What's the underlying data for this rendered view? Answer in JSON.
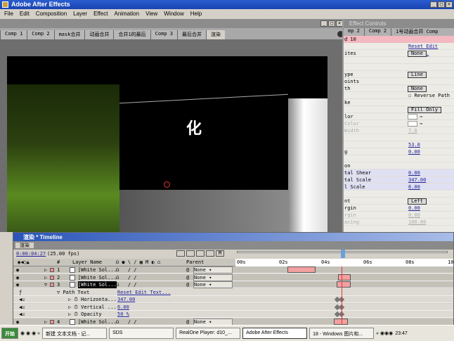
{
  "app": {
    "title": "Adobe After Effects"
  },
  "menu": [
    "File",
    "Edit",
    "Composition",
    "Layer",
    "Effect",
    "Animation",
    "View",
    "Window",
    "Help"
  ],
  "comp_tabs": [
    "Comp 1",
    "Comp 2",
    "mask合并",
    "动画合并",
    "合并1的最后",
    "Comp 3",
    "最后合并",
    "渲染"
  ],
  "viewer": {
    "text": "化"
  },
  "effect_controls": {
    "title": "Effect Controls",
    "tabs": [
      "mp 2",
      "Comp 2",
      "1号动画合并 Comp"
    ],
    "layer": "d 10",
    "rows": [
      {
        "label": "",
        "value": "Reset Edit Text..."
      },
      {
        "label": "ites",
        "value": "None"
      },
      {
        "label": "",
        "value": ""
      },
      {
        "label": "",
        "value": ""
      },
      {
        "label": "ype",
        "value": "Line"
      },
      {
        "label": "oints",
        "value": ""
      },
      {
        "label": "th",
        "value": "None"
      },
      {
        "label": "",
        "value": "Reverse Path"
      },
      {
        "label": "ke",
        "value": ""
      },
      {
        "label": "",
        "value": "Fill Only"
      },
      {
        "label": "lor",
        "value": ""
      },
      {
        "label": "Color",
        "value": ""
      },
      {
        "label": "Width",
        "value": "7.0"
      },
      {
        "label": "",
        "value": ""
      },
      {
        "label": "",
        "value": "53.0"
      },
      {
        "label": "g",
        "value": "0.00"
      },
      {
        "label": "",
        "value": ""
      },
      {
        "label": "on",
        "value": ""
      },
      {
        "label": "tal Shear",
        "value": "0.00"
      },
      {
        "label": "tal Scale",
        "value": "347.00"
      },
      {
        "label": "l Scale",
        "value": "6.00"
      },
      {
        "label": "",
        "value": ""
      },
      {
        "label": "nt",
        "value": "Left"
      },
      {
        "label": "rgin",
        "value": "0.00"
      },
      {
        "label": "rgin",
        "value": "0.00"
      },
      {
        "label": "acing",
        "value": "100.00"
      }
    ]
  },
  "timeline": {
    "title": "渲染 * Timeline",
    "tab": "渲染",
    "timecode": "0:00:04:27",
    "fps": "(25.00 fps)",
    "columns": {
      "num": "#",
      "layer_name": "Layer Name",
      "parent": "Parent"
    },
    "ruler": [
      "00s",
      "02s",
      "04s",
      "06s",
      "08s",
      "10"
    ],
    "layers": [
      {
        "num": "1",
        "name": "[White Sol...",
        "parent": "None"
      },
      {
        "num": "2",
        "name": "[White Sol...",
        "parent": "None"
      },
      {
        "num": "3",
        "name": "[White Sol...",
        "parent": "None"
      },
      {
        "num": "4",
        "name": "[White Sol...",
        "parent": "None"
      }
    ],
    "props": [
      {
        "name": "Path Text",
        "value": "Reset Edit Text..."
      },
      {
        "name": "Horizonta...",
        "value": "347.00"
      },
      {
        "name": "Vertical ...",
        "value": "6.00"
      },
      {
        "name": "Opacity",
        "value": "50 %"
      }
    ]
  },
  "taskbar": {
    "start": "开始",
    "tasks": [
      "新建 文本文档 - 记...",
      "SDS",
      "RealOne Player: d10_...",
      "Adobe After Effects",
      "18 - Windows 图片和..."
    ],
    "clock": "23:47"
  }
}
